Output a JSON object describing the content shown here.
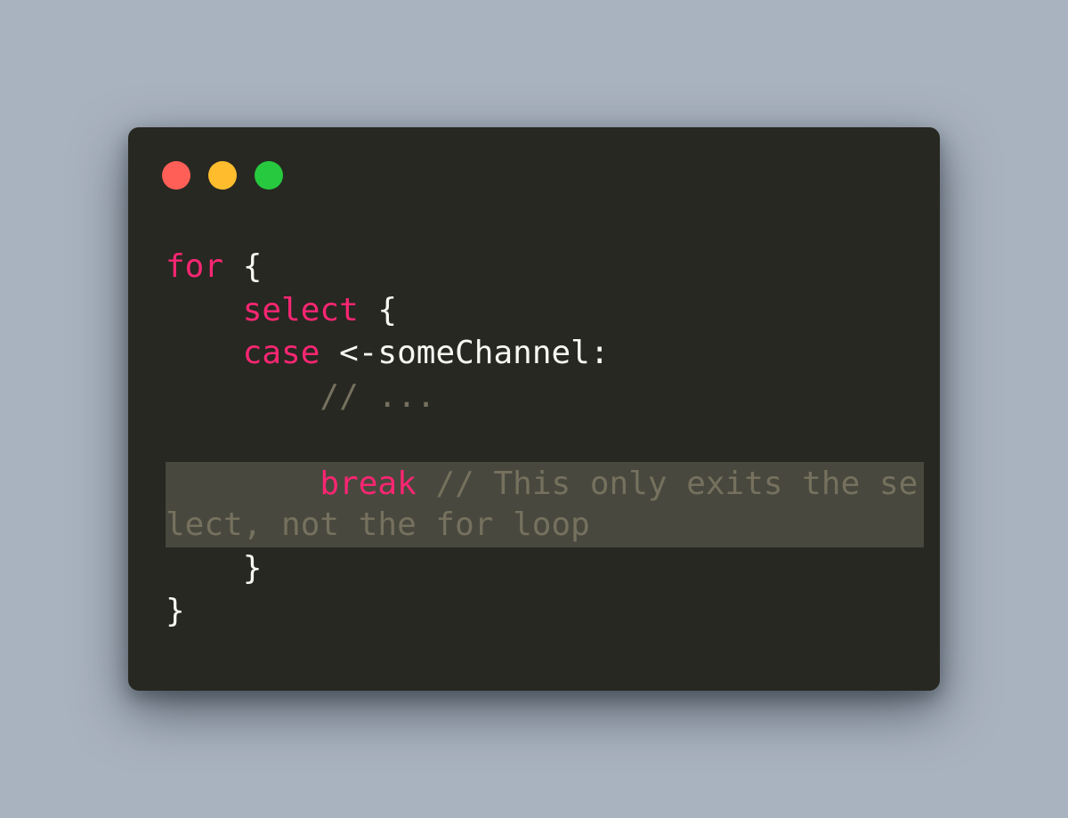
{
  "window": {
    "controls": [
      {
        "name": "close",
        "color": "#ff5f56"
      },
      {
        "name": "minimize",
        "color": "#ffbd2e"
      },
      {
        "name": "zoom",
        "color": "#27c93f"
      }
    ]
  },
  "theme": {
    "background": "#272822",
    "keyword": "#f92672",
    "text": "#f8f8f2",
    "comment": "#75715e",
    "highlight": "#49483e"
  },
  "code": {
    "lines": [
      {
        "indent": "",
        "kw": "for",
        "text": " {",
        "comment": ""
      },
      {
        "indent": "    ",
        "kw": "select",
        "text": " {",
        "comment": ""
      },
      {
        "indent": "    ",
        "kw": "case",
        "text": " <-someChannel:",
        "comment": ""
      },
      {
        "indent": "        ",
        "kw": "",
        "text": "",
        "comment": "// ..."
      },
      {
        "indent": "",
        "kw": "",
        "text": "",
        "comment": ""
      },
      {
        "indent": "        ",
        "kw": "break",
        "text": " ",
        "comment": "// This only exits the select, not the for loop"
      },
      {
        "indent": "    ",
        "kw": "",
        "text": "}",
        "comment": ""
      },
      {
        "indent": "",
        "kw": "",
        "text": "}",
        "comment": ""
      }
    ]
  }
}
